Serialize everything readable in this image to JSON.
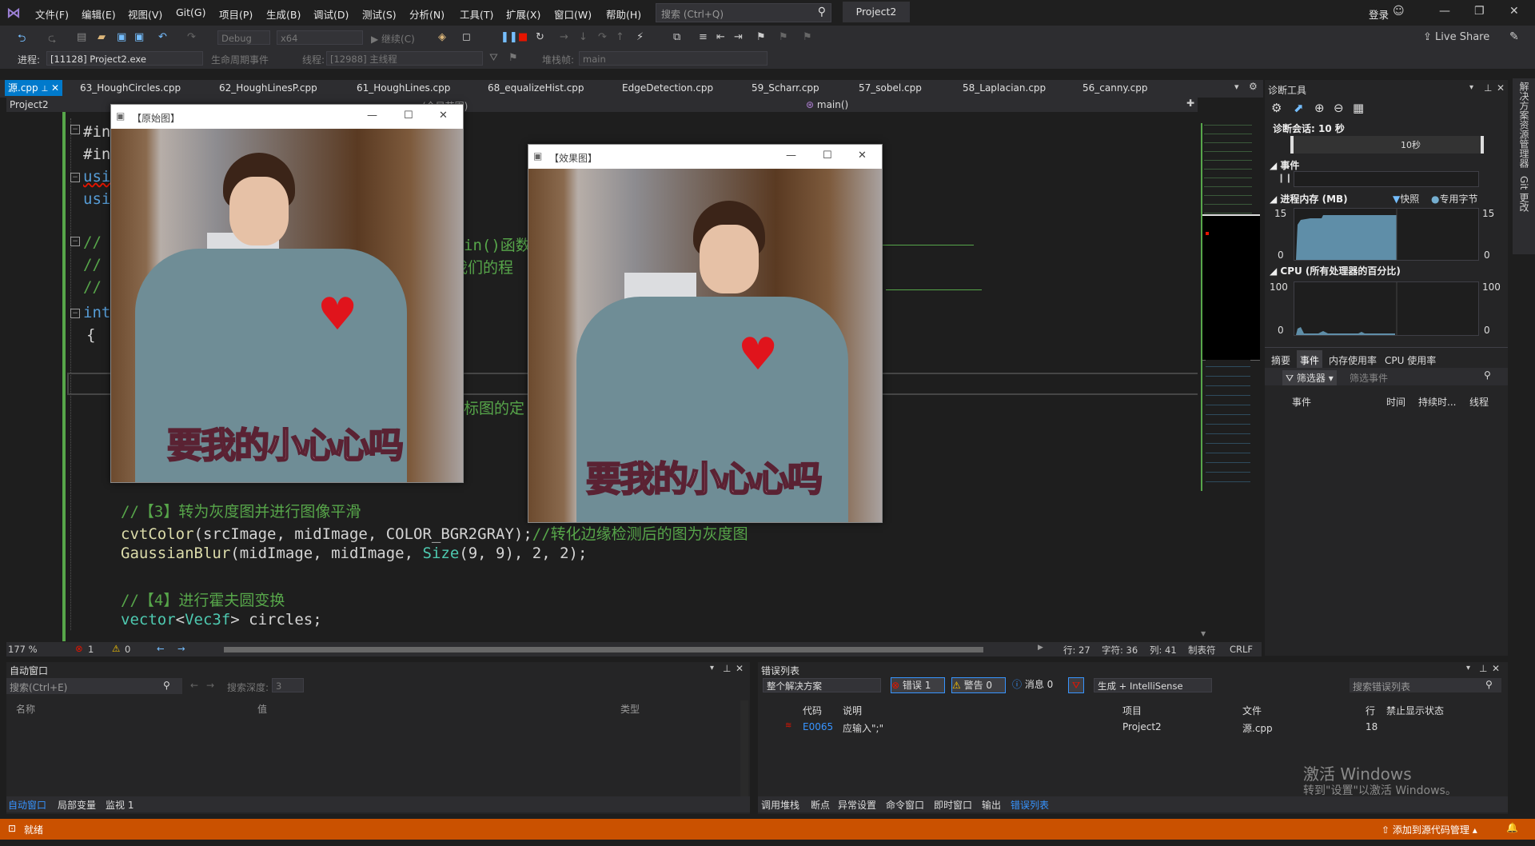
{
  "menu": [
    "文件(F)",
    "编辑(E)",
    "视图(V)",
    "Git(G)",
    "项目(P)",
    "生成(B)",
    "调试(D)",
    "测试(S)",
    "分析(N)",
    "工具(T)",
    "扩展(X)",
    "窗口(W)",
    "帮助(H)"
  ],
  "search": {
    "placeholder": "搜索 (Ctrl+Q)"
  },
  "project_title": "Project2",
  "login": "登录",
  "toolbar": {
    "config": "Debug",
    "platform": "x64",
    "continue": "继续(C)",
    "live_share": "Live Share"
  },
  "toolbar2": {
    "process_label": "进程:",
    "process_value": "[11128] Project2.exe",
    "lifecycle": "生命周期事件",
    "thread_label": "线程:",
    "thread_value": "[12988] 主线程",
    "stack_label": "堆栈帧:",
    "stack_value": "main"
  },
  "tabs": [
    "源.cpp",
    "63_HoughCircles.cpp",
    "62_HoughLinesP.cpp",
    "61_HoughLines.cpp",
    "68_equalizeHist.cpp",
    "EdgeDetection.cpp",
    "59_Scharr.cpp",
    "57_sobel.cpp",
    "58_Laplacian.cpp",
    "56_canny.cpp"
  ],
  "navbar": {
    "project": "Project2",
    "scope": "(全局范围)",
    "func": "main()"
  },
  "code": {
    "l1": "#in",
    "l2": "#in",
    "l3": "usi",
    "l4": "usi",
    "l5_tail": "in()函数",
    "l6_tail": "我们的程",
    "l7": "int",
    "l8": "{",
    "l10_tail": "标图的定",
    "c3": "//【3】转为灰度图并进行图像平滑",
    "cvt_fn": "cvtColor",
    "cvt_args": "(srcImage, midImage, COLOR_BGR2GRAY);",
    "cvt_cm": "//转化边缘检测后的图为灰度图",
    "gb_fn": "GaussianBlur",
    "gb_a": "(midImage, midImage, ",
    "gb_ty": "Size",
    "gb_b": "(9, 9), 2, 2);",
    "c4": "//【4】进行霍夫圆变换",
    "vec_ty": "vector",
    "vec_lt": "<",
    "vec_t2": "Vec3f",
    "vec_rest": "> circles;"
  },
  "win_orig": {
    "title": "【原始图】",
    "caption": "要我的小心心吗"
  },
  "win_eff": {
    "title": "【效果图】",
    "caption": "要我的小心心吗"
  },
  "editor_status": {
    "zoom": "177 %",
    "errors": "1",
    "warnings": "0",
    "line": "行: 27",
    "char": "字符: 36",
    "col": "列: 41",
    "tabs": "制表符",
    "eol": "CRLF"
  },
  "diag": {
    "title": "诊断工具",
    "session": "诊断会话: 10 秒",
    "tick": "10秒",
    "events_header": "事件",
    "mem_header": "进程内存 (MB)",
    "mem_legend1": "快照",
    "mem_legend2": "专用字节",
    "mem_max": "15",
    "mem_min": "0",
    "cpu_header": "CPU (所有处理器的百分比)",
    "cpu_max": "100",
    "cpu_min": "0",
    "tabs": [
      "摘要",
      "事件",
      "内存使用率",
      "CPU 使用率"
    ],
    "filter": "筛选器",
    "filter_ph": "筛选事件",
    "cols": [
      "事件",
      "时间",
      "持续时...",
      "线程"
    ]
  },
  "side_tabs": [
    "解决方案资源管理器",
    "Git 更改"
  ],
  "autowin": {
    "title": "自动窗口",
    "search_ph": "搜索(Ctrl+E)",
    "depth_label": "搜索深度:",
    "depth_val": "3",
    "cols": [
      "名称",
      "值",
      "类型"
    ],
    "tabs": [
      "自动窗口",
      "局部变量",
      "监视 1"
    ]
  },
  "errwin": {
    "title": "错误列表",
    "scope": "整个解决方案",
    "errors_btn": "错误 1",
    "warnings_btn": "警告 0",
    "messages_btn": "消息 0",
    "build": "生成 + IntelliSense",
    "search_ph": "搜索错误列表",
    "cols": [
      "代码",
      "说明",
      "项目",
      "文件",
      "行",
      "禁止显示状态"
    ],
    "row": {
      "code": "E0065",
      "desc": "应输入\";\"",
      "project": "Project2",
      "file": "源.cpp",
      "line": "18"
    },
    "tabs": [
      "调用堆栈",
      "断点",
      "异常设置",
      "命令窗口",
      "即时窗口",
      "输出",
      "错误列表"
    ],
    "activate1": "激活 Windows",
    "activate2": "转到\"设置\"以激活 Windows。"
  },
  "status": {
    "ready": "就绪",
    "source_control": "添加到源代码管理"
  }
}
